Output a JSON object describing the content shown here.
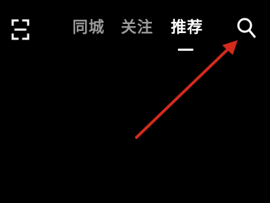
{
  "top_bar": {
    "scan_icon": "scan-icon",
    "search_icon": "search-icon",
    "tabs": [
      {
        "label": "同城",
        "active": false
      },
      {
        "label": "关注",
        "active": false
      },
      {
        "label": "推荐",
        "active": true
      }
    ]
  },
  "annotation": {
    "type": "arrow",
    "points_to": "search-button",
    "color": "#d42a1e"
  },
  "colors": {
    "background": "#000000",
    "tab_inactive": "#9a9a9a",
    "tab_active": "#ffffff"
  }
}
